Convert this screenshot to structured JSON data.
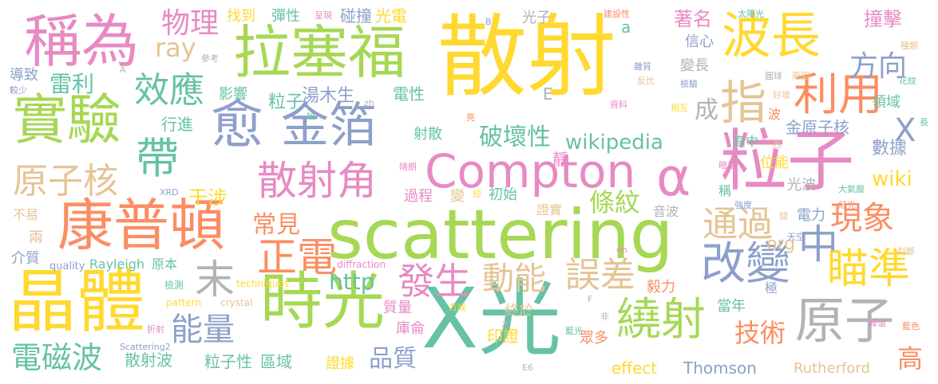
{
  "palette": {
    "yellow": "#ffd92f",
    "green": "#a6d854",
    "teal": "#66c2a5",
    "orange": "#fc8d62",
    "blue": "#8da0cb",
    "pink": "#e78ac3",
    "tan": "#e5c494",
    "gray": "#b3b3b3"
  },
  "words": [
    {
      "text": "散射",
      "color": "yellow"
    },
    {
      "text": "scattering",
      "color": "green"
    },
    {
      "text": "X光",
      "color": "teal"
    },
    {
      "text": "粒子",
      "color": "pink"
    },
    {
      "text": "康普頓",
      "color": "orange"
    },
    {
      "text": "晶體",
      "color": "yellow"
    },
    {
      "text": "時光",
      "color": "green"
    },
    {
      "text": "拉塞福",
      "color": "green"
    },
    {
      "text": "稱為",
      "color": "pink"
    },
    {
      "text": "實驗",
      "color": "green"
    },
    {
      "text": "波長",
      "color": "yellow"
    },
    {
      "text": "愈",
      "color": "blue"
    },
    {
      "text": "金箔",
      "color": "blue"
    },
    {
      "text": "Compton",
      "color": "pink"
    },
    {
      "text": "α",
      "color": "pink"
    },
    {
      "text": "指",
      "color": "tan"
    },
    {
      "text": "利用",
      "color": "orange"
    },
    {
      "text": "原子",
      "color": "gray"
    },
    {
      "text": "繞射",
      "color": "green"
    },
    {
      "text": "改變",
      "color": "blue"
    },
    {
      "text": "瞄準",
      "color": "yellow"
    },
    {
      "text": "中",
      "color": "blue"
    },
    {
      "text": "散射角",
      "color": "pink"
    },
    {
      "text": "效應",
      "color": "teal"
    },
    {
      "text": "帶",
      "color": "teal"
    },
    {
      "text": "原子核",
      "color": "tan"
    },
    {
      "text": "正電",
      "color": "orange"
    },
    {
      "text": "末",
      "color": "gray"
    },
    {
      "text": "發生",
      "color": "pink"
    },
    {
      "text": "動能",
      "color": "tan"
    },
    {
      "text": "誤差",
      "color": "tan"
    },
    {
      "text": "能量",
      "color": "blue"
    },
    {
      "text": "電磁波",
      "color": "teal"
    },
    {
      "text": "現象",
      "color": "orange"
    },
    {
      "text": "通過",
      "color": "tan"
    },
    {
      "text": "方向",
      "color": "blue"
    },
    {
      "text": "物理",
      "color": "pink"
    },
    {
      "text": "雷利",
      "color": "teal"
    },
    {
      "text": "ray",
      "color": "tan"
    },
    {
      "text": "破壞性",
      "color": "teal"
    },
    {
      "text": "wikipedia",
      "color": "teal"
    },
    {
      "text": "常見",
      "color": "orange"
    },
    {
      "text": "條紋",
      "color": "green"
    },
    {
      "text": "技術",
      "color": "orange"
    },
    {
      "text": "http",
      "color": "teal"
    },
    {
      "text": "品質",
      "color": "blue"
    },
    {
      "text": "X",
      "color": "blue"
    },
    {
      "text": "高",
      "color": "orange"
    },
    {
      "text": "光子",
      "color": "gray"
    },
    {
      "text": "彈性",
      "color": "teal"
    },
    {
      "text": "碰撞",
      "color": "blue"
    },
    {
      "text": "光電",
      "color": "yellow"
    },
    {
      "text": "找到",
      "color": "yellow"
    },
    {
      "text": "著名",
      "color": "pink"
    },
    {
      "text": "撞擊",
      "color": "pink"
    },
    {
      "text": "成",
      "color": "gray"
    },
    {
      "text": "干涉",
      "color": "yellow"
    },
    {
      "text": "粒子",
      "color": "teal"
    },
    {
      "text": "湯木生",
      "color": "blue"
    },
    {
      "text": "電性",
      "color": "teal"
    },
    {
      "text": "wiki",
      "color": "yellow"
    },
    {
      "text": "org",
      "color": "tan"
    },
    {
      "text": "金原子核",
      "color": "blue"
    },
    {
      "text": "數據",
      "color": "blue"
    },
    {
      "text": "位能",
      "color": "yellow"
    },
    {
      "text": "光波",
      "color": "gray"
    },
    {
      "text": "電力",
      "color": "blue"
    },
    {
      "text": "Thomson",
      "color": "blue"
    },
    {
      "text": "effect",
      "color": "yellow"
    },
    {
      "text": "Rutherford",
      "color": "tan"
    },
    {
      "text": "散射波",
      "color": "teal"
    },
    {
      "text": "粒子性",
      "color": "teal"
    },
    {
      "text": "區域",
      "color": "teal"
    },
    {
      "text": "證據",
      "color": "yellow"
    },
    {
      "text": "庫侖",
      "color": "pink"
    },
    {
      "text": "印證",
      "color": "yellow"
    },
    {
      "text": "眾多",
      "color": "orange"
    },
    {
      "text": "質量",
      "color": "pink"
    },
    {
      "text": "終於",
      "color": "tan"
    },
    {
      "text": "毅力",
      "color": "orange"
    },
    {
      "text": "當年",
      "color": "teal"
    },
    {
      "text": "過程",
      "color": "pink"
    },
    {
      "text": "變",
      "color": "tan"
    },
    {
      "text": "初始",
      "color": "teal"
    },
    {
      "text": "證實",
      "color": "tan"
    },
    {
      "text": "音波",
      "color": "gray"
    },
    {
      "text": "射散",
      "color": "teal"
    },
    {
      "text": "靜",
      "color": "pink"
    },
    {
      "text": "行進",
      "color": "teal"
    },
    {
      "text": "影響",
      "color": "teal"
    },
    {
      "text": "導致",
      "color": "blue"
    },
    {
      "text": "介質",
      "color": "blue"
    },
    {
      "text": "兩",
      "color": "tan"
    },
    {
      "text": "不易",
      "color": "tan"
    },
    {
      "text": "原本",
      "color": "teal"
    },
    {
      "text": "Rayleigh",
      "color": "teal"
    },
    {
      "text": "quality",
      "color": "blue"
    },
    {
      "text": "領域",
      "color": "teal"
    },
    {
      "text": "變長",
      "color": "gray"
    },
    {
      "text": "信心",
      "color": "blue"
    },
    {
      "text": "高中",
      "color": "teal"
    },
    {
      "text": "波",
      "color": "orange"
    },
    {
      "text": "稱",
      "color": "teal"
    },
    {
      "text": "極",
      "color": "blue"
    },
    {
      "text": "E",
      "color": "gray"
    },
    {
      "text": "a",
      "color": "teal"
    },
    {
      "text": "techniques",
      "color": "yellow"
    },
    {
      "text": "pattern",
      "color": "yellow"
    },
    {
      "text": "crystal",
      "color": "tan"
    },
    {
      "text": "diffraction",
      "color": "pink"
    },
    {
      "text": "Scattering2",
      "color": "blue"
    },
    {
      "text": "檢測",
      "color": "teal"
    },
    {
      "text": "XRD",
      "color": "blue"
    },
    {
      "text": "參考",
      "color": "gray"
    },
    {
      "text": "較少",
      "color": "blue"
    },
    {
      "text": "A",
      "color": "gray"
    },
    {
      "text": "zh",
      "color": "gray"
    },
    {
      "text": "繞",
      "color": "teal"
    },
    {
      "text": "亮",
      "color": "orange"
    },
    {
      "text": "呈現",
      "color": "pink"
    },
    {
      "text": "B",
      "color": "blue"
    },
    {
      "text": "建設性",
      "color": "orange"
    },
    {
      "text": "太陽光",
      "color": "teal"
    },
    {
      "text": "種類",
      "color": "tan"
    },
    {
      "text": "雜質",
      "color": "blue"
    },
    {
      "text": "反比",
      "color": "tan"
    },
    {
      "text": "檢驗",
      "color": "blue"
    },
    {
      "text": "圓球",
      "color": "gray"
    },
    {
      "text": "原因",
      "color": "tan"
    },
    {
      "text": "好壞",
      "color": "tan"
    },
    {
      "text": "花紋",
      "color": "teal"
    },
    {
      "text": "相互",
      "color": "yellow"
    },
    {
      "text": "資料",
      "color": "pink"
    },
    {
      "text": "晴朗",
      "color": "pink"
    },
    {
      "text": "短",
      "color": "yellow"
    },
    {
      "text": "暗相",
      "color": "pink"
    },
    {
      "text": "西",
      "color": "tan"
    },
    {
      "text": "長",
      "color": "teal"
    },
    {
      "text": "大氣層",
      "color": "teal"
    },
    {
      "text": "強度",
      "color": "blue"
    },
    {
      "text": "間",
      "color": "tan"
    },
    {
      "text": "紅光",
      "color": "orange"
    },
    {
      "text": "天空",
      "color": "blue"
    },
    {
      "text": "判斷",
      "color": "tan"
    },
    {
      "text": "en",
      "color": "pink"
    },
    {
      "text": "折射",
      "color": "pink"
    },
    {
      "text": "方成",
      "color": "yellow"
    },
    {
      "text": "F",
      "color": "gray"
    },
    {
      "text": "非",
      "color": "gray"
    },
    {
      "text": "次",
      "color": "gray"
    },
    {
      "text": "藍光",
      "color": "teal"
    },
    {
      "text": "E6",
      "color": "gray"
    },
    {
      "text": "峰值",
      "color": "pink"
    },
    {
      "text": "藍色",
      "color": "orange"
    }
  ]
}
